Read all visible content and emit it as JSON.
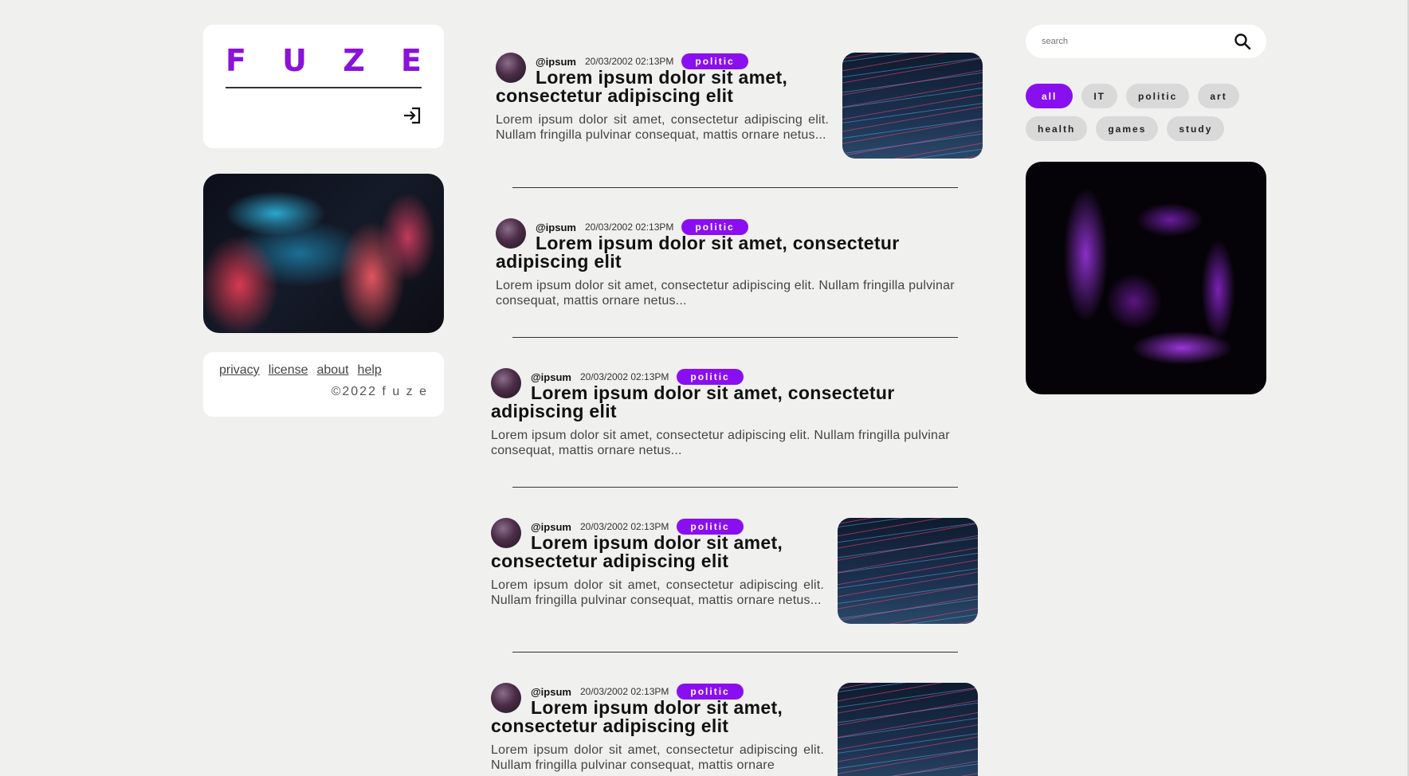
{
  "brand": {
    "letters": [
      "F",
      "U",
      "Z",
      "E"
    ]
  },
  "footer": {
    "links": [
      "privacy",
      "license",
      "about",
      "help"
    ],
    "copyright": "©2022  f u z e"
  },
  "search": {
    "placeholder": "search"
  },
  "categories": [
    "all",
    "IT",
    "politic",
    "art",
    "health",
    "games",
    "study"
  ],
  "active_category": "all",
  "posts": [
    {
      "author": "@ipsum",
      "date": "20/03/2002 02:13PM",
      "tag": "politic",
      "title": "Lorem ipsum dolor sit amet, consectetur adipiscing elit",
      "excerpt": "Lorem ipsum dolor sit amet, consectetur adipiscing elit. Nullam fringilla pulvinar consequat, mattis ornare netus...",
      "has_image": true
    },
    {
      "author": "@ipsum",
      "date": "20/03/2002 02:13PM",
      "tag": "politic",
      "title": "Lorem ipsum dolor sit amet, consectetur adipiscing elit",
      "excerpt": "Lorem ipsum dolor sit amet, consectetur adipiscing elit. Nullam fringilla pulvinar consequat, mattis ornare netus...",
      "has_image": false
    },
    {
      "author": "@ipsum",
      "date": "20/03/2002 02:13PM",
      "tag": "politic",
      "title": "Lorem ipsum dolor sit amet, consectetur adipiscing elit",
      "excerpt": "Lorem ipsum dolor sit amet, consectetur adipiscing elit. Nullam fringilla pulvinar consequat, mattis ornare netus...",
      "has_image": false
    },
    {
      "author": "@ipsum",
      "date": "20/03/2002 02:13PM",
      "tag": "politic",
      "title": "Lorem ipsum dolor sit amet, consectetur adipiscing elit",
      "excerpt": "Lorem ipsum dolor sit amet, consectetur adipiscing elit. Nullam fringilla pulvinar consequat, mattis ornare netus...",
      "has_image": true
    },
    {
      "author": "@ipsum",
      "date": "20/03/2002 02:13PM",
      "tag": "politic",
      "title": "Lorem ipsum dolor sit amet, consectetur adipiscing elit",
      "excerpt": "Lorem ipsum dolor sit amet, consectetur adipiscing elit. Nullam fringilla pulvinar consequat, mattis ornare",
      "has_image": true
    }
  ],
  "colors": {
    "accent": "#8a0ff0",
    "background": "#f0f0ef",
    "chip": "#d9d9d9"
  }
}
